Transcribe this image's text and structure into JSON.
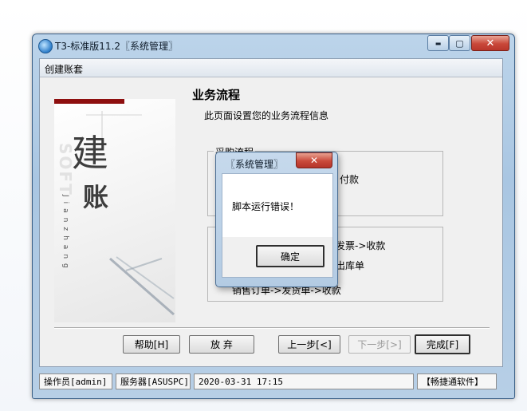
{
  "window": {
    "title": "T3-标准版11.2〖系统管理〗",
    "minimize_symbol": "▬",
    "maximize_symbol": "▢",
    "close_symbol": "✕"
  },
  "wizard": {
    "title": "创建账套",
    "left_panel": {
      "char_1": "建",
      "char_2": "账",
      "vertical_small": "Jianzhang"
    },
    "section_title": "业务流程",
    "section_subtitle": "此页面设置您的业务流程信息",
    "purchase_group": {
      "label": "采购流程",
      "line1_tail": "付款"
    },
    "sales_group": {
      "line1_tail": "发票->收款",
      "line2_tail": "出库单",
      "line3": "销售订单->发货单->收款"
    },
    "buttons": {
      "help": "帮助[H]",
      "abandon": "放 弃",
      "prev": "上一步[<]",
      "next": "下一步[>]",
      "finish": "完成[F]"
    }
  },
  "status_bar": {
    "operator": "操作员[admin]",
    "server": "服务器[ASUSPC]",
    "datetime": "2020-03-31 17:15",
    "company": "【畅捷通软件】"
  },
  "dialog": {
    "title": "〖系统管理〗",
    "close_symbol": "✕",
    "message": "脚本运行错误！",
    "ok_label": "确定"
  }
}
